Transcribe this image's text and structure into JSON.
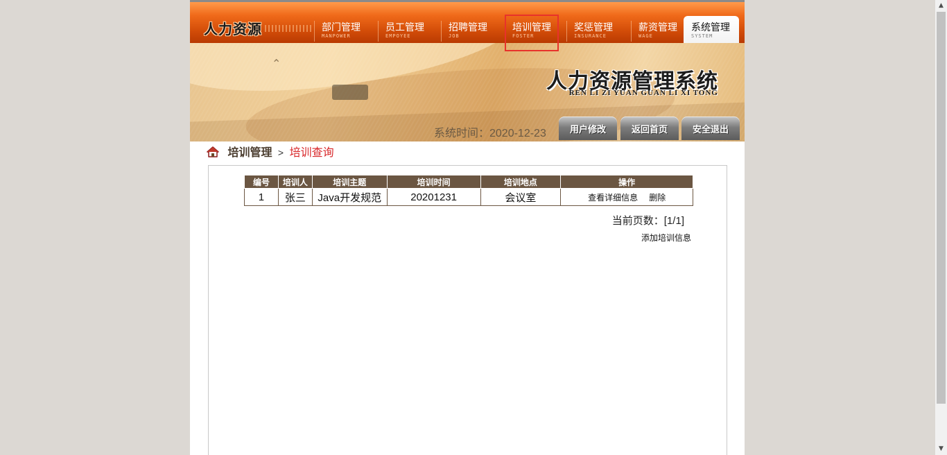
{
  "app": {
    "logo": "人力资源",
    "system_title": "人力资源管理系统",
    "system_pinyin": "REN LI ZI YUAN GUAN LI XI TONG"
  },
  "nav": {
    "items": [
      {
        "label": "部门管理",
        "sub": "MANPOWER"
      },
      {
        "label": "员工管理",
        "sub": "EMPOYEE"
      },
      {
        "label": "招聘管理",
        "sub": "JOB"
      },
      {
        "label": "培训管理",
        "sub": "FOSTER"
      },
      {
        "label": "奖惩管理",
        "sub": "INSURANCE"
      },
      {
        "label": "薪资管理",
        "sub": "WAGE"
      },
      {
        "label": "系统管理",
        "sub": "SYSTEM"
      }
    ]
  },
  "banner": {
    "time_label": "系统时间：2020-12-23",
    "buttons": {
      "user_edit": "用户修改",
      "back_home": "返回首页",
      "logout": "安全退出"
    }
  },
  "breadcrumb": {
    "parent": "培训管理",
    "separator": ">",
    "current": "培训查询"
  },
  "table": {
    "headers": {
      "id": "编号",
      "trainer": "培训人",
      "topic": "培训主题",
      "time": "培训时间",
      "location": "培训地点",
      "ops": "操作"
    },
    "rows": [
      {
        "id": "1",
        "trainer": "张三",
        "topic": "Java开发规范",
        "time": "20201231",
        "location": "会议室",
        "view": "查看详细信息",
        "delete": "删除"
      }
    ]
  },
  "pagination": {
    "text": "当前页数：[1/1]"
  },
  "actions": {
    "add": "添加培训信息"
  },
  "colors": {
    "nav_orange": "#d24c08",
    "table_header": "#6b5642",
    "highlight_red": "#d8272a"
  }
}
